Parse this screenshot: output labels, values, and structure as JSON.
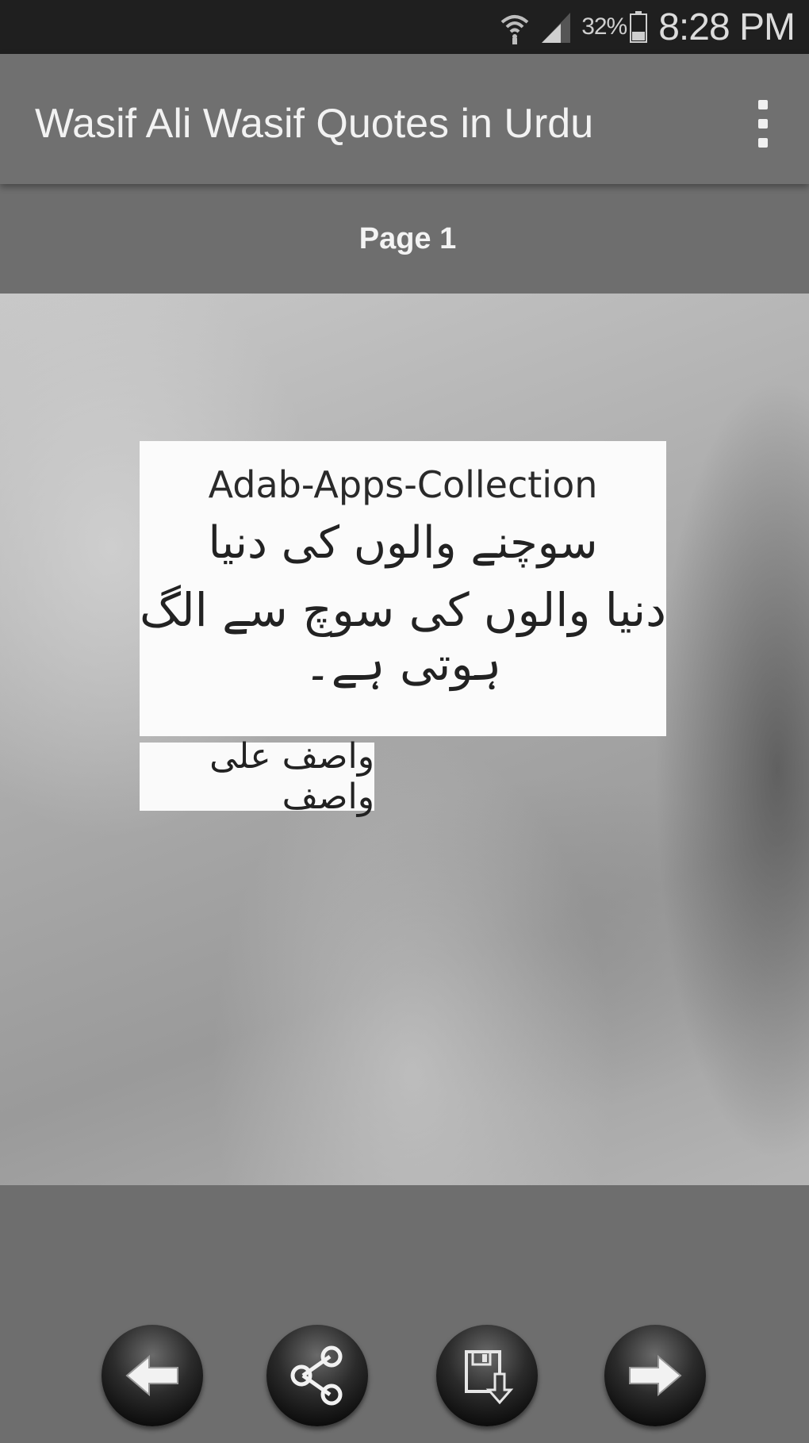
{
  "status_bar": {
    "battery_percent": "32%",
    "time": "8:28 PM",
    "icons": [
      "wifi-icon",
      "signal-icon",
      "battery-icon"
    ]
  },
  "app_bar": {
    "title": "Wasif Ali Wasif Quotes in Urdu",
    "overflow_icon": "more-vert-icon"
  },
  "page_bar": {
    "label": "Page 1"
  },
  "quote": {
    "brand": "Adab-Apps-Collection",
    "line1": "سوچنے والوں کی دنیا",
    "line2": "دنیا والوں کی سوچ سے الگ ہوتی ہے۔",
    "author": "واصف علی واصف"
  },
  "bottom_nav": {
    "buttons": [
      "arrow-left-icon",
      "share-icon",
      "save-icon",
      "arrow-right-icon"
    ]
  }
}
